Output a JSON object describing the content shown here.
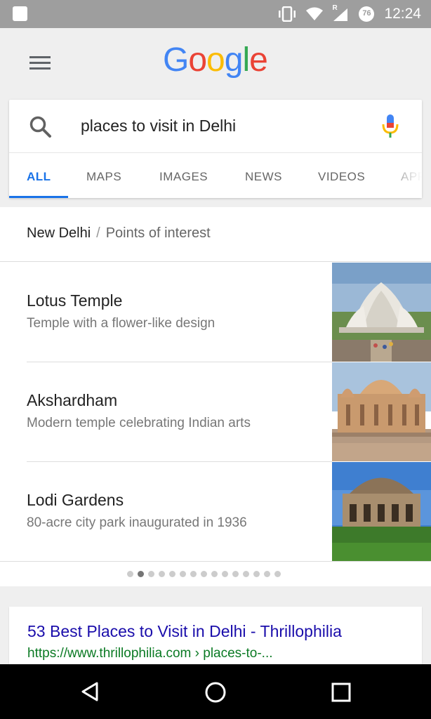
{
  "status_bar": {
    "time": "12:24",
    "battery_level": "76",
    "network_badge": "R"
  },
  "header": {
    "logo_letters": [
      "G",
      "o",
      "o",
      "g",
      "l",
      "e"
    ],
    "logo_colors": [
      "#4285F4",
      "#EA4335",
      "#FBBC05",
      "#4285F4",
      "#34A853",
      "#EA4335"
    ]
  },
  "search": {
    "query": "places to visit in Delhi"
  },
  "tabs": [
    {
      "label": "ALL",
      "active": true
    },
    {
      "label": "MAPS",
      "active": false
    },
    {
      "label": "IMAGES",
      "active": false
    },
    {
      "label": "NEWS",
      "active": false
    },
    {
      "label": "VIDEOS",
      "active": false
    },
    {
      "label": "APPS",
      "active": false
    }
  ],
  "places": {
    "breadcrumb_city": "New Delhi",
    "breadcrumb_separator": "/",
    "breadcrumb_category": "Points of interest",
    "items": [
      {
        "title": "Lotus Temple",
        "description": "Temple with a flower-like design"
      },
      {
        "title": "Akshardham",
        "description": "Modern temple celebrating Indian arts"
      },
      {
        "title": "Lodi Gardens",
        "description": "80-acre city park inaugurated in 1936"
      }
    ],
    "page_count": 15,
    "active_page": 2
  },
  "result": {
    "title": "53 Best Places to Visit in Delhi - Thrillophilia",
    "url": "https://www.thrillophilia.com › places-to-..."
  },
  "colors": {
    "accent": "#1a73e8",
    "link": "#1a0dab",
    "url": "#0b7a24"
  }
}
